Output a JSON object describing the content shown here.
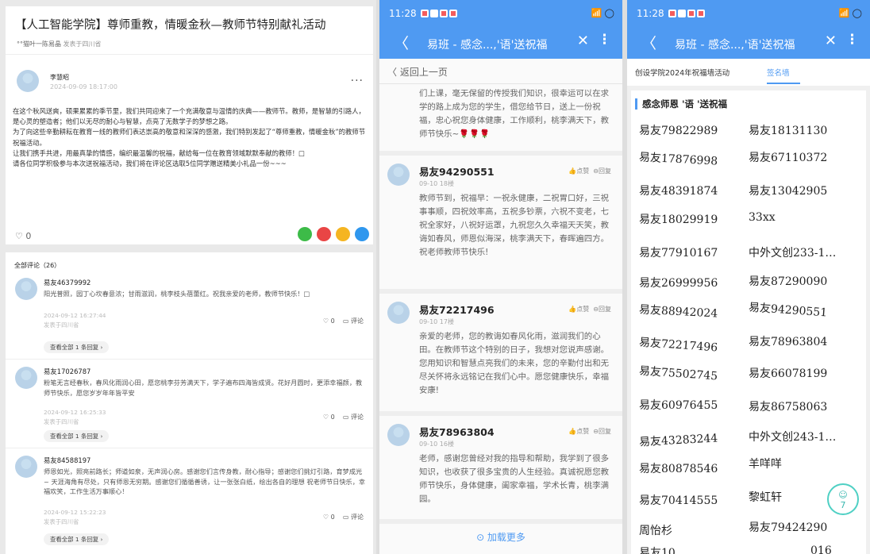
{
  "article": {
    "title": "【人工智能学院】尊师重教，情暖金秋—教师节特别献礼活动",
    "sub_tag": "°°猫叶一陈易晶",
    "sub_loc": "发表于四川省",
    "author": "李慧昭",
    "time": "2024-09-09 18:17:00",
    "more": "···",
    "paragraphs": [
      "在这个秋风送爽，硕果累累的季节里，我们共同迎来了一个充满敬意与温情的庆典——教师节。教师，是智慧的引路人，是心灵的塑造者；他们以无尽的耐心与智慧，点亮了无数学子的梦想之路。",
      "为了向这些辛勤耕耘在教育一线的教师们表达崇高的敬意和深深的感激，我们特别发起了“尊师重教，情暖金秋”的教师节祝福活动。",
      "让我们携手共进，用最真挚的情感，编织最温馨的祝福，献给每一位在教育领域默默奉献的教师！□",
      "请各位同学积极参与本次送祝福活动，我们将在评论区选取5位同学赠送精美小礼品一份~~~"
    ],
    "likes": "0"
  },
  "comments": {
    "title": "全部评论（26）",
    "items": [
      {
        "name": "易友46379992",
        "text": "阳光普照，园丁心坎春意浓；甘雨滋润，桃李枝头蓓蕾红。祝我亲爱的老师，教师节快乐！□",
        "time": "2024-09-12 16:27:44",
        "loc": "发表于四川省",
        "likes": "0",
        "reply": "评论",
        "more": "查看全部 1 条回复 ›"
      },
      {
        "name": "易友17026787",
        "text": "粉笔无言经春秋，春风化雨润心田，愿您桃李芬芳满天下，学子遍布四海皆成贤。花好月圆时，更添幸福颜，教师节快乐，愿您岁岁年年皆平安",
        "time": "2024-09-12 16:25:33",
        "loc": "发表于四川省",
        "likes": "0",
        "reply": "评论",
        "more": "查看全部 1 条回复 ›"
      },
      {
        "name": "易友84588197",
        "text": "师恩如光，照亮前路长；师道如泉，无声润心房。感谢您们言传身教，耐心指导；感谢您们挑灯引路，育梦成光~ 天涯海角有尽处，只有师恩无穷期。感谢您们循循善诱，让一张张白纸，绘出各自的理想 祝老师节日快乐，幸福欢笑，工作生活万事顺心！",
        "time": "2024-09-12 15:22:23",
        "loc": "发表于四川省",
        "likes": "0",
        "reply": "评论",
        "more": "查看全部 1 条回复 ›"
      }
    ]
  },
  "phone": {
    "time": "11:28",
    "signal": "📶 ◯",
    "nav_title": "易班 - 感念...,'语'送祝福",
    "back_icon": "〈",
    "close_icon": "✕",
    "more_icon": "⋮"
  },
  "messages_panel": {
    "back_label": "〈 返回上一页",
    "first_text": "们上课，毫无保留的传授我们知识，很幸运可以在求学的路上成为您的学生，借您给节日，送上一份祝福，忠心祝您身体健康，工作顺利，桃李满天下，教师节快乐~🌹🌹🌹",
    "items": [
      {
        "name": "易友94290551",
        "floor": "09-10 18楼",
        "like": "👍点赞",
        "reply": "⊖回复",
        "text": "教师节到，祝福早：一祝永健康，二祝胃口好，三祝事事顺，四祝效率高，五祝多钞票，六祝不变老，七祝全家好，八祝好运罩，九祝您久久幸福天天笑，教诲如春风，师恩似海深，桃李满天下，春晖遍四方。祝老师教师节快乐!"
      },
      {
        "name": "易友72217496",
        "floor": "09-10 17楼",
        "like": "👍点赞",
        "reply": "⊖回复",
        "text": "亲爱的老师，您的教诲如春风化雨，滋润我们的心田。在教师节这个特别的日子，我想对您说声感谢。您用知识和智慧点亮我们的未来，您的辛勤付出和无尽关怀将永远铭记在我们心中。愿您健康快乐，幸福安康!"
      },
      {
        "name": "易友78963804",
        "floor": "09-10 16楼",
        "like": "👍点赞",
        "reply": "⊖回复",
        "text": "老师，感谢您曾经对我的指导和帮助，我学到了很多知识，也收获了很多宝贵的人生经验。真诚祝愿您教师节快乐，身体健康，阖家幸福，学术长青，桃李满园。"
      }
    ],
    "load_more": "⊙ 加载更多"
  },
  "signwall": {
    "tab1": "创设学院2024年祝福墙活动",
    "tab2": "签名墙",
    "title": "感念师恩 '语 '送祝福",
    "names": [
      "易友79822989",
      "易友18131130",
      "易友17876998",
      "易友67110372",
      "易友48391874",
      "易友13042905",
      "易友18029919",
      "33xx",
      "易友77910167",
      "中外文创233-1…",
      "易友26999956",
      "易友87290090",
      "易友88942024",
      "易友94290551",
      "易友72217496",
      "易友78963804",
      "易友75502745",
      "易友66078199",
      "易友60976455",
      "易友86758063",
      "易友43283244",
      "中外文创243-1…",
      "易友80878546",
      "羊咩咩",
      "易友70414555",
      "黎虹轩",
      "周怡杉",
      "易友79424290",
      "易友10",
      "016"
    ],
    "float_count": "7"
  },
  "colors": {
    "accent": "#4f9af2"
  }
}
